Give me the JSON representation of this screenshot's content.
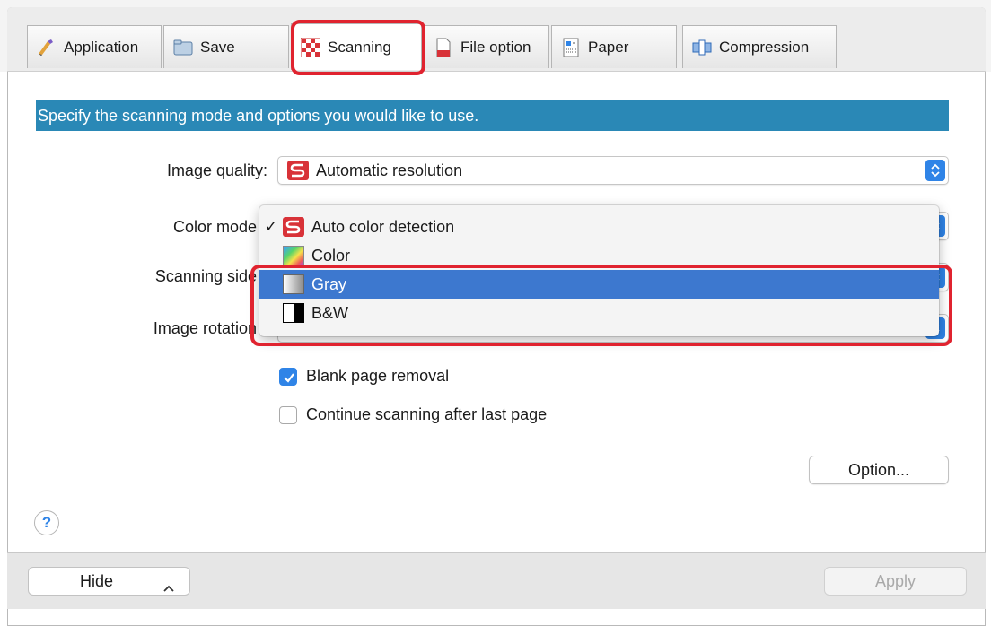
{
  "tabs": [
    {
      "label": "Application"
    },
    {
      "label": "Save"
    },
    {
      "label": "Scanning"
    },
    {
      "label": "File option"
    },
    {
      "label": "Paper"
    },
    {
      "label": "Compression"
    }
  ],
  "active_tab": "Scanning",
  "banner": "Specify the scanning mode and options you would like to use.",
  "image_quality": {
    "label": "Image quality:",
    "value": "Automatic resolution"
  },
  "color_mode": {
    "label": "Color mode",
    "options": [
      {
        "label": "Auto color detection",
        "checked": true,
        "icon": "s-logo-icon"
      },
      {
        "label": "Color",
        "icon": "color-gradient-icon"
      },
      {
        "label": "Gray",
        "icon": "gray-gradient-icon",
        "highlighted": true
      },
      {
        "label": "B&W",
        "icon": "black-white-icon"
      }
    ]
  },
  "scanning_side": {
    "label": "Scanning side"
  },
  "image_rotation": {
    "label": "Image rotation"
  },
  "options": {
    "blank_page_removal": {
      "label": "Blank page removal",
      "checked": true
    },
    "continue_scanning": {
      "label": "Continue scanning after last page",
      "checked": false
    }
  },
  "option_button": "Option...",
  "help": "?",
  "footer": {
    "hide_label": "Hide",
    "apply_label": "Apply"
  },
  "colors": {
    "accent": "#2f84e7",
    "banner": "#2a88b6",
    "menu_selection": "#3d78cf",
    "annotation": "#e0232f"
  }
}
